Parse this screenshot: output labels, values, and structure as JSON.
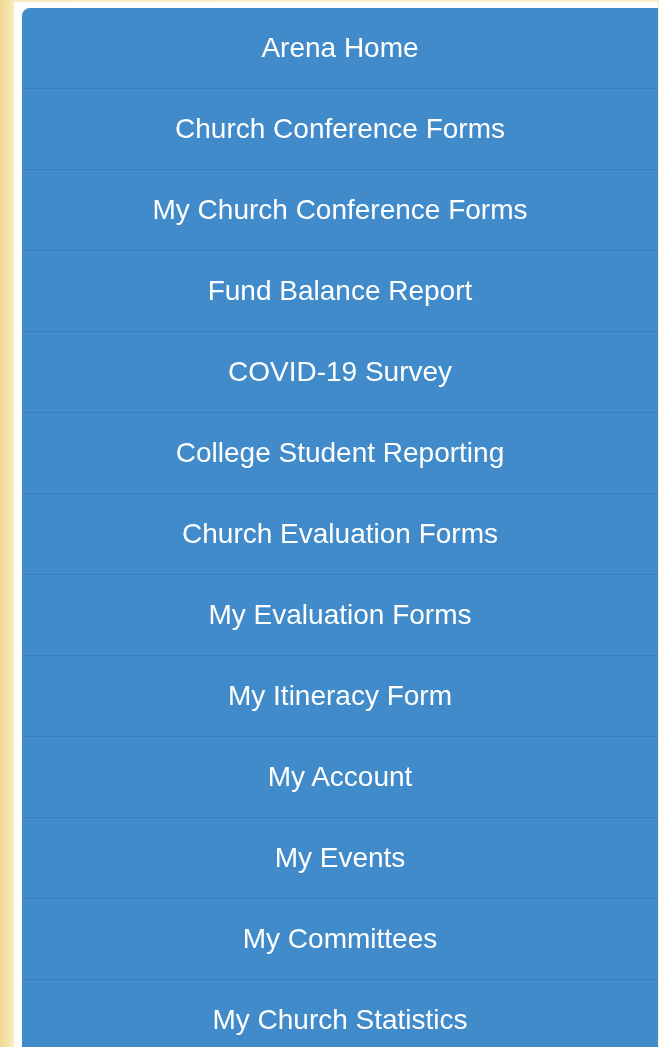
{
  "menu": {
    "items": [
      {
        "label": "Arena Home"
      },
      {
        "label": "Church Conference Forms"
      },
      {
        "label": "My Church Conference Forms"
      },
      {
        "label": "Fund Balance Report"
      },
      {
        "label": "COVID-19 Survey"
      },
      {
        "label": "College Student Reporting"
      },
      {
        "label": "Church Evaluation Forms"
      },
      {
        "label": "My Evaluation Forms"
      },
      {
        "label": "My Itineracy Form"
      },
      {
        "label": "My Account"
      },
      {
        "label": "My Events"
      },
      {
        "label": "My Committees"
      },
      {
        "label": "My Church Statistics"
      }
    ]
  }
}
